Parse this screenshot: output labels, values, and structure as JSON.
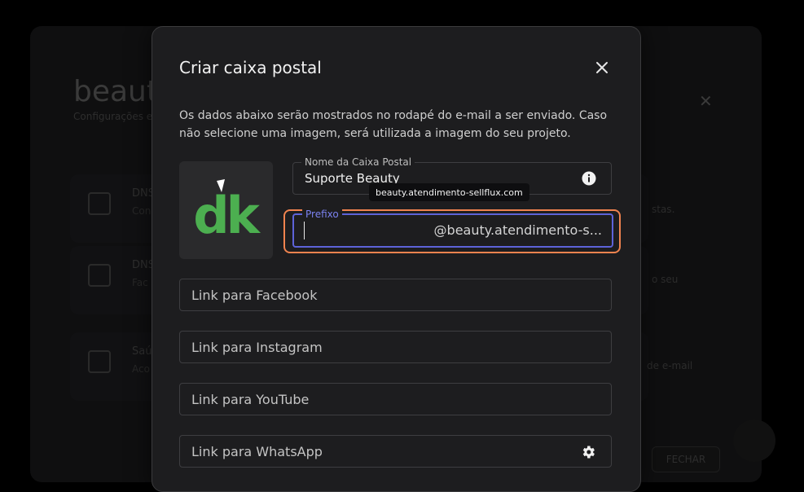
{
  "background": {
    "title": "beaut",
    "subtitle": "Configurações e",
    "items": [
      {
        "title": "DNS",
        "desc": "Con"
      },
      {
        "title": "DNS",
        "desc": "Fac"
      },
      {
        "title": "Saú",
        "desc": "Aco"
      }
    ],
    "right_texts": [
      "stas.",
      "o seu",
      "de e-mail"
    ],
    "close_glyph": "✕",
    "fechar_label": "FECHAR"
  },
  "modal": {
    "title": "Criar caixa postal",
    "description": "Os dados abaixo serão mostrados no rodapé do e-mail a ser enviado. Caso não selecione uma imagem, será utilizada a imagem do seu projeto.",
    "mailbox_name": {
      "label": "Nome da Caixa Postal",
      "value": "Suporte Beauty"
    },
    "tooltip": "beauty.atendimento-sellflux.com",
    "prefix": {
      "label": "Prefixo",
      "value": "",
      "suffix": "@beauty.atendimento-s..."
    },
    "links": [
      {
        "placeholder": "Link para Facebook"
      },
      {
        "placeholder": "Link para Instagram"
      },
      {
        "placeholder": "Link para YouTube"
      },
      {
        "placeholder": "Link para WhatsApp"
      }
    ],
    "logo_text": "dk"
  },
  "colors": {
    "accent_focus": "#5d63d8",
    "focus_ring": "#f0834f",
    "logo_green": "#4caf50"
  }
}
